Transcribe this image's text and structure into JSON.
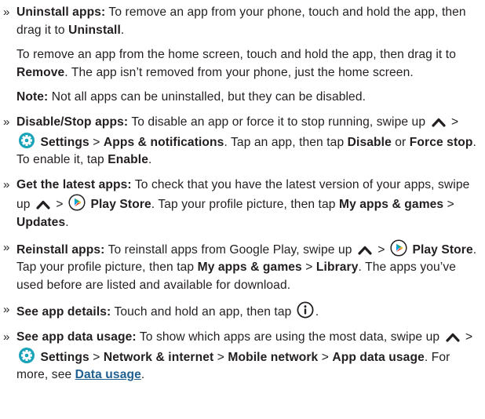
{
  "bullet_marker": "»",
  "items": [
    {
      "kind": "bullet",
      "name": "uninstall-apps",
      "parts": [
        {
          "b": "Uninstall apps:"
        },
        {
          "t": " To remove an app from your phone, touch and hold the app, then drag it to "
        },
        {
          "b": "Uninstall"
        },
        {
          "t": "."
        }
      ]
    },
    {
      "kind": "para",
      "name": "remove-from-home",
      "parts": [
        {
          "t": "To remove an app from the home screen, touch and hold the app, then drag it to "
        },
        {
          "b": "Remove"
        },
        {
          "t": ". The app isn’t removed from your phone, just the home screen."
        }
      ]
    },
    {
      "kind": "para",
      "name": "uninstall-note",
      "parts": [
        {
          "b": "Note:"
        },
        {
          "t": " Not all apps can be uninstalled, but they can be disabled."
        }
      ]
    },
    {
      "kind": "bullet",
      "name": "disable-stop-apps",
      "parts": [
        {
          "b": "Disable/Stop apps:"
        },
        {
          "t": " To disable an app or force it to stop running, swipe up "
        },
        {
          "icon": "caret-up-icon"
        },
        {
          "t": " > "
        },
        {
          "icon": "settings-gear-icon"
        },
        {
          "t": " "
        },
        {
          "b": "Settings"
        },
        {
          "t": " > "
        },
        {
          "b": "Apps & notifications"
        },
        {
          "t": ". Tap an app, then tap "
        },
        {
          "b": "Disable"
        },
        {
          "t": " or "
        },
        {
          "b": "Force stop"
        },
        {
          "t": ". To enable it, tap "
        },
        {
          "b": "Enable"
        },
        {
          "t": "."
        }
      ]
    },
    {
      "kind": "bullet",
      "name": "get-latest-apps",
      "parts": [
        {
          "b": "Get the latest apps:"
        },
        {
          "t": " To check that you have the latest version of your apps, swipe up "
        },
        {
          "icon": "caret-up-icon"
        },
        {
          "t": " > "
        },
        {
          "icon": "play-store-icon"
        },
        {
          "t": " "
        },
        {
          "b": "Play Store"
        },
        {
          "t": ". Tap your profile picture, then tap "
        },
        {
          "b": "My apps & games"
        },
        {
          "t": " > "
        },
        {
          "b": "Updates"
        },
        {
          "t": "."
        }
      ]
    },
    {
      "kind": "bullet",
      "name": "reinstall-apps",
      "parts": [
        {
          "b": "Reinstall apps:"
        },
        {
          "t": " To reinstall apps from Google Play, swipe up "
        },
        {
          "icon": "caret-up-icon"
        },
        {
          "t": " > "
        },
        {
          "icon": "play-store-icon"
        },
        {
          "t": " "
        },
        {
          "b": "Play Store"
        },
        {
          "t": ". Tap your profile picture, then tap "
        },
        {
          "b": "My apps & games"
        },
        {
          "t": " > "
        },
        {
          "b": "Library"
        },
        {
          "t": ". The apps you’ve used before are listed and available for download."
        }
      ]
    },
    {
      "kind": "bullet",
      "name": "see-app-details",
      "parts": [
        {
          "b": "See app details:"
        },
        {
          "t": " Touch and hold an app, then tap "
        },
        {
          "icon": "info-icon"
        },
        {
          "t": "."
        }
      ]
    },
    {
      "kind": "bullet",
      "name": "see-app-data-usage",
      "parts": [
        {
          "b": "See app data usage:"
        },
        {
          "t": " To show which apps are using the most data, swipe up "
        },
        {
          "icon": "caret-up-icon"
        },
        {
          "t": " > "
        },
        {
          "icon": "settings-gear-icon"
        },
        {
          "t": " "
        },
        {
          "b": "Settings"
        },
        {
          "t": " > "
        },
        {
          "b": "Network & internet"
        },
        {
          "t": " > "
        },
        {
          "b": "Mobile network"
        },
        {
          "t": " > "
        },
        {
          "b": "App data usage"
        },
        {
          "t": ". For more, see "
        },
        {
          "link": "Data usage"
        },
        {
          "t": "."
        }
      ]
    }
  ]
}
